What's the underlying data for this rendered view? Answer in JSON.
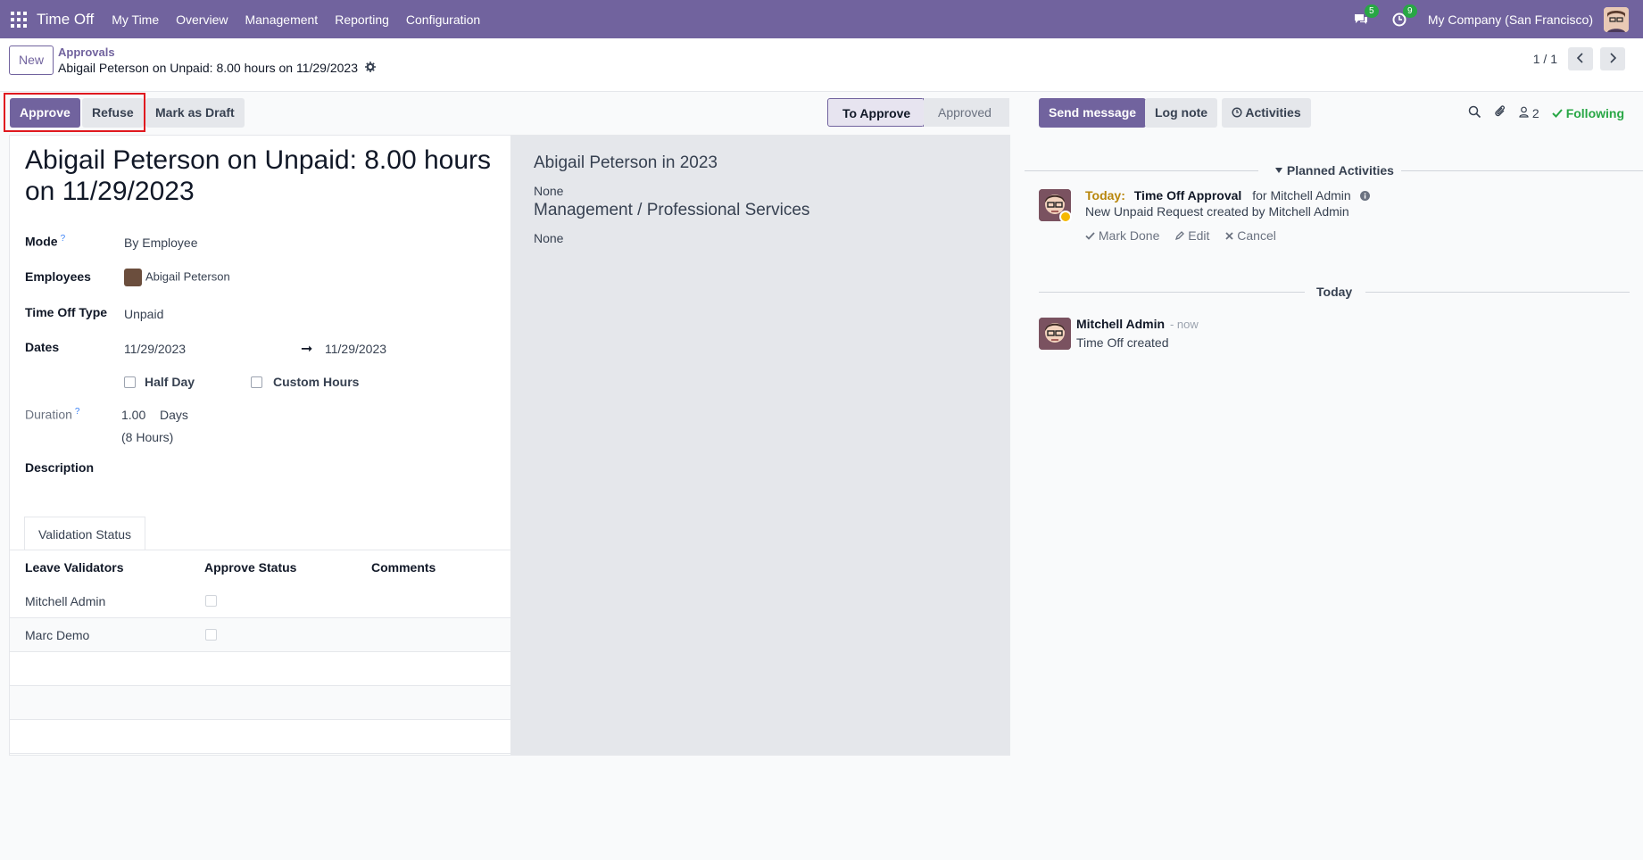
{
  "nav": {
    "app_name": "Time Off",
    "menu": [
      "My Time",
      "Overview",
      "Management",
      "Reporting",
      "Configuration"
    ],
    "messages_badge": "5",
    "activities_badge": "9",
    "company": "My Company (San Francisco)"
  },
  "control": {
    "new_label": "New",
    "breadcrumb_parent": "Approvals",
    "breadcrumb_current": "Abigail Peterson on Unpaid: 8.00 hours on 11/29/2023",
    "pager": "1 / 1"
  },
  "actions": {
    "approve": "Approve",
    "refuse": "Refuse",
    "draft": "Mark as Draft",
    "stages": [
      "To Approve",
      "Approved"
    ]
  },
  "form": {
    "title": "Abigail Peterson on Unpaid: 8.00 hours on 11/29/2023",
    "mode_label": "Mode",
    "mode_value": "By Employee",
    "employees_label": "Employees",
    "employee": "Abigail Peterson",
    "type_label": "Time Off Type",
    "type_value": "Unpaid",
    "dates_label": "Dates",
    "date_from": "11/29/2023",
    "arrow": "➞",
    "date_to": "11/29/2023",
    "half_day": "Half Day",
    "custom_hours": "Custom Hours",
    "duration_label": "Duration",
    "duration_value": "1.00",
    "duration_unit": "Days",
    "duration_hours": "(8 Hours)",
    "description_label": "Description",
    "tab": "Validation Status",
    "table_headers": [
      "Leave Validators",
      "Approve Status",
      "Comments"
    ],
    "rows": [
      "Mitchell Admin",
      "Marc Demo"
    ]
  },
  "side_panel": {
    "title1": "Abigail Peterson in 2023",
    "val1": "None",
    "title2": "Management / Professional Services",
    "val2": "None"
  },
  "chatter": {
    "send": "Send message",
    "log": "Log note",
    "activities": "Activities",
    "followers_count": "2",
    "following": "Following",
    "planned": "Planned Activities",
    "act_today": "Today:",
    "act_title": "Time Off Approval",
    "act_for": "for Mitchell Admin",
    "act_desc": "New Unpaid Request created by Mitchell Admin",
    "mark_done": "Mark Done",
    "edit": "Edit",
    "cancel": "Cancel",
    "today_sep": "Today",
    "msg_author": "Mitchell Admin",
    "msg_time": "- now",
    "msg_body": "Time Off created"
  }
}
